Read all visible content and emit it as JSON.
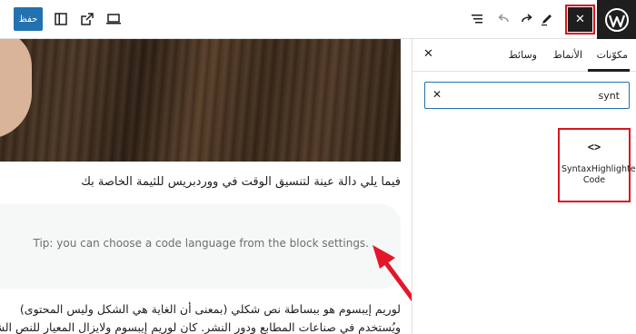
{
  "toolbar": {
    "save_label": "حفظ",
    "inserter_close_glyph": "✕",
    "icons": [
      "wordpress-logo",
      "close",
      "pen",
      "redo",
      "undo",
      "list-view",
      "desktop-preview",
      "external-link",
      "sidebar-toggle"
    ]
  },
  "canvas": {
    "paragraph_intro": "فيما يلي دالة عينة لتنسيق الوقت في ووردبريس للثيمة الخاصة بك",
    "code_placeholder": "Tip: you can choose a code language from the block settings.",
    "paragraph_lorem_line1": "لوريم إيبسوم هو ببساطة نص شكلي (بمعنى أن الغاية هي الشكل وليس المحتوى)",
    "paragraph_lorem_line2": "ويُستخدم في صناعات المطابع ودور النشر. كان لوريم إيبسوم ولايزال المعيار للنص الشكلي"
  },
  "sidebar": {
    "tabs": [
      {
        "label": "مكوّنات",
        "active": true
      },
      {
        "label": "الأنماط",
        "active": false
      },
      {
        "label": "وسائط",
        "active": false
      }
    ],
    "close_glyph": "✕",
    "search": {
      "value": "synt",
      "clear_glyph": "✕"
    },
    "results": [
      {
        "icon_glyph": "<>",
        "label": "SyntaxHighlighter Code"
      }
    ]
  },
  "colors": {
    "accent": "#2271b1",
    "dark": "#1e1e1e",
    "highlight_red": "#d9151f"
  }
}
